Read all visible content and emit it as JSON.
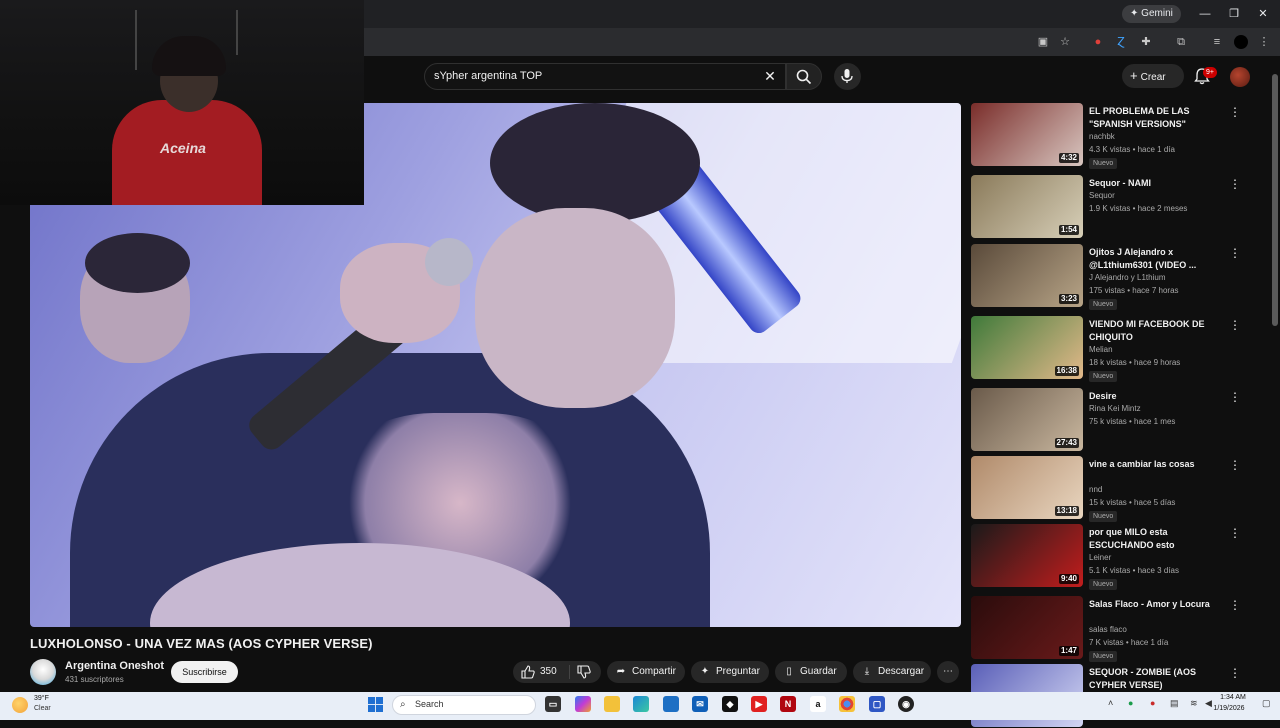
{
  "browser": {
    "gemini_label": "Gemini",
    "window_controls": [
      "—",
      "❐",
      "✕"
    ]
  },
  "header": {
    "search_value": "sYpher argentina TOP",
    "create_label": "Crear",
    "notifications_badge": "9+"
  },
  "webcam": {
    "shirt_text": "Aceina"
  },
  "video": {
    "title": "LUXHOLONSO - UNA VEZ MAS (AOS CYPHER VERSE)",
    "channel_name": "Argentina Oneshot",
    "subscribers": "431 suscriptores",
    "subscribe_label": "Suscribirse",
    "likes": "350",
    "share_label": "Compartir",
    "ask_label": "Preguntar",
    "save_label": "Guardar",
    "download_label": "Descargar"
  },
  "recommendations": [
    {
      "title": "EL PROBLEMA DE LAS \"SPANISH VERSIONS\"",
      "channel": "nachbk",
      "meta": "4.3 K vistas • hace 1 día",
      "badge": "Nuevo",
      "duration": "4:32",
      "thumb_colors": [
        "#7a2d2a",
        "#d8c6c0"
      ]
    },
    {
      "title": "Sequor - NAMI",
      "channel": "Sequor",
      "meta": "1.9 K vistas • hace 2 meses",
      "badge": "",
      "duration": "1:54",
      "thumb_colors": [
        "#8a7a5a",
        "#d7cfb8"
      ]
    },
    {
      "title": "Ojitos J Alejandro x @L1thium6301 (VIDEO ...",
      "channel": "J Alejandro y L1thium",
      "meta": "175 vistas • hace 7 horas",
      "badge": "Nuevo",
      "duration": "3:23",
      "thumb_colors": [
        "#5a4a3a",
        "#b7a487"
      ]
    },
    {
      "title": "VIENDO MI FACEBOOK DE CHIQUITO",
      "channel": "Melian",
      "meta": "18 k vistas • hace 9 horas",
      "badge": "Nuevo",
      "duration": "16:38",
      "thumb_colors": [
        "#3f7a3a",
        "#e3b98a"
      ]
    },
    {
      "title": "Desire",
      "channel": "Rina Kei Mintz",
      "meta": "75 k vistas • hace 1 mes",
      "badge": "",
      "duration": "27:43",
      "thumb_colors": [
        "#6a5a4a",
        "#c9b79f"
      ]
    },
    {
      "title": "vine a cambiar las cosas",
      "channel": "nnd",
      "meta": "15 k vistas • hace 5 días",
      "badge": "Nuevo",
      "duration": "13:18",
      "thumb_colors": [
        "#b08a6a",
        "#e9d6c0"
      ]
    },
    {
      "title": "por que MILO esta ESCUCHANDO esto",
      "channel": "Leiner",
      "meta": "5.1 K vistas • hace 3 días",
      "badge": "Nuevo",
      "duration": "9:40",
      "thumb_colors": [
        "#1a1a1a",
        "#c21d1d"
      ]
    },
    {
      "title": "Salas Flaco - Amor y Locura",
      "channel": "salas flaco",
      "meta": "7 K vistas • hace 1 día",
      "badge": "Nuevo",
      "duration": "1:47",
      "thumb_colors": [
        "#2a0c0c",
        "#6a1a1a"
      ]
    },
    {
      "title": "SEQUOR - ZOMBIE (AOS CYPHER VERSE)",
      "channel": "",
      "meta": "",
      "badge": "",
      "duration": "",
      "thumb_colors": [
        "#5a5fb8",
        "#d3d6f3"
      ]
    }
  ],
  "taskbar": {
    "weather_temp": "39°F",
    "weather_cond": "Clear",
    "search_placeholder": "Search",
    "time": "1:34 AM",
    "date": "1/19/2026"
  }
}
